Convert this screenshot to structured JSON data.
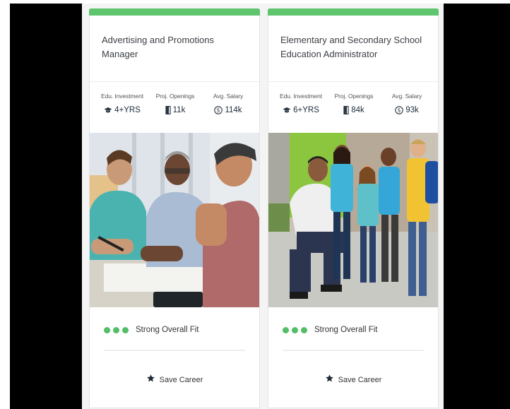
{
  "cards": [
    {
      "title": "Advertising and Promotions Manager",
      "stats": [
        {
          "label": "Edu. Investment",
          "value": "4+YRS",
          "icon": "graduation-cap-icon"
        },
        {
          "label": "Proj. Openings",
          "value": "11k",
          "icon": "door-icon"
        },
        {
          "label": "Avg. Salary",
          "value": "114k",
          "icon": "dollar-coin-icon"
        }
      ],
      "fit_label": "Strong Overall Fit",
      "fit_dots": 3,
      "save_label": "Save Career"
    },
    {
      "title": "Elementary and Secondary School Education Administrator",
      "stats": [
        {
          "label": "Edu. Investment",
          "value": "6+YRS",
          "icon": "graduation-cap-icon"
        },
        {
          "label": "Proj. Openings",
          "value": "84k",
          "icon": "door-icon"
        },
        {
          "label": "Avg. Salary",
          "value": "93k",
          "icon": "dollar-coin-icon"
        }
      ],
      "fit_label": "Strong Overall Fit",
      "fit_dots": 3,
      "save_label": "Save Career"
    }
  ],
  "colors": {
    "accent_green": "#5ec46e",
    "fit_dot_green": "#52be68",
    "text_dark": "#1d2b3a"
  }
}
